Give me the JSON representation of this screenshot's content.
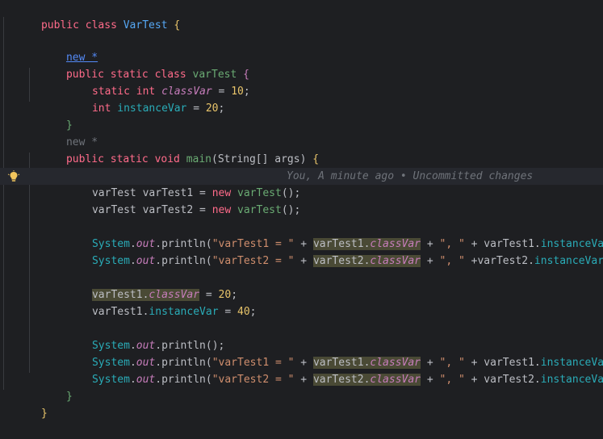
{
  "editor": {
    "class_decl": {
      "kw1": "public",
      "kw2": "class",
      "name": "VarTest",
      "brace": "{"
    },
    "hint_new": "new *",
    "inner_decl": {
      "kw1": "public",
      "kw2": "static",
      "kw3": "class",
      "name": "varTest",
      "brace": "{"
    },
    "field1": {
      "kw1": "static",
      "type": "int",
      "name": "classVar",
      "op": "=",
      "value": "10",
      "end": ";"
    },
    "field2": {
      "type": "int",
      "name": "instanceVar",
      "op": "=",
      "value": "20",
      "end": ";"
    },
    "close_inner": "}",
    "hint_new2": "new *",
    "main_decl": {
      "kw1": "public",
      "kw2": "static",
      "kw3": "void",
      "name": "main",
      "params": "(String[] args)",
      "brace": "{"
    },
    "line_obj1": {
      "type": "varTest",
      "var": "varTest1",
      "op": "=",
      "kw": "new",
      "ctor": "varTest",
      "rest": "();"
    },
    "ghost_text": "You, A minute ago • Uncommitted changes",
    "line_obj2": {
      "type": "varTest",
      "var": "varTest2",
      "op": "=",
      "kw": "new",
      "ctor": "varTest",
      "rest": "();"
    },
    "print1": {
      "sys": "System",
      "out": "out",
      "m": "println",
      "str1": "\"varTest1 = \"",
      "obj": "varTest1",
      "f1": "classVar",
      "sep": "\", \"",
      "obj2": "varTest1",
      "f2": "instanceVar"
    },
    "print2": {
      "sys": "System",
      "out": "out",
      "m": "println",
      "str1": "\"varTest2 = \"",
      "obj": "varTest2",
      "f1": "classVar",
      "sep": "\", \"",
      "obj2": "varTest2",
      "f2": "instanceVar"
    },
    "assign1": {
      "obj": "varTest1",
      "f": "classVar",
      "op": "=",
      "value": "20"
    },
    "assign2": {
      "obj": "varTest1",
      "f": "instanceVar",
      "op": "=",
      "value": "40"
    },
    "print_empty": {
      "sys": "System",
      "out": "out",
      "m": "println",
      "rest": "();"
    },
    "print3": {
      "sys": "System",
      "out": "out",
      "m": "println",
      "str1": "\"varTest1 = \"",
      "obj": "varTest1",
      "f1": "classVar",
      "sep": "\", \"",
      "obj2": "varTest1",
      "f2": "instanceVar"
    },
    "print4": {
      "sys": "System",
      "out": "out",
      "m": "println",
      "str1": "\"varTest2 = \"",
      "obj": "varTest2",
      "f1": "classVar",
      "sep": "\", \"",
      "obj2": "varTest2",
      "f2": "instanceVar"
    },
    "close_main": "}",
    "close_class": "}"
  },
  "colors": {
    "background": "#1e1f22",
    "keyword": "#cf8e6d",
    "string": "#6aab73",
    "field": "#c77dbb",
    "method": "#56a8f5",
    "number": "#2aacb8"
  },
  "icons": {
    "gutter": "lightbulb-icon"
  }
}
